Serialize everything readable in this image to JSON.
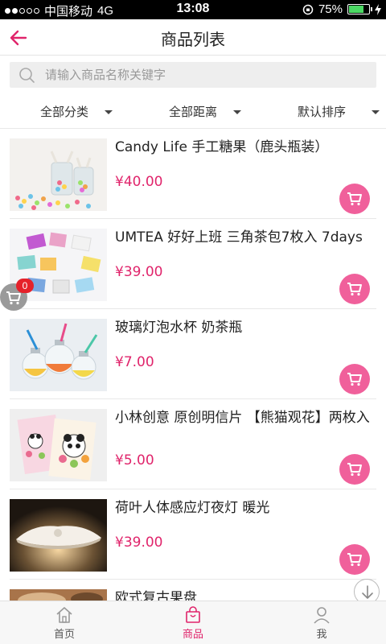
{
  "status_bar": {
    "carrier": "中国移动",
    "network": "4G",
    "time": "13:08",
    "battery": "75%",
    "battery_level": 0.75
  },
  "header": {
    "title": "商品列表",
    "back_icon": "back-arrow-icon"
  },
  "search": {
    "placeholder": "请输入商品名称关键字"
  },
  "filters": [
    {
      "label": "全部分类"
    },
    {
      "label": "全部距离"
    },
    {
      "label": "默认排序"
    }
  ],
  "products": [
    {
      "name": "Candy Life 手工糖果（鹿头瓶装）",
      "price": "¥40.00"
    },
    {
      "name": "UMTEA 好好上班 三角茶包7枚入 7days",
      "price": "¥39.00"
    },
    {
      "name": "玻璃灯泡水杯 奶茶瓶",
      "price": "¥7.00"
    },
    {
      "name": "小林创意 原创明信片 【熊猫观花】两枚入",
      "price": "¥5.00"
    },
    {
      "name": "荷叶人体感应灯夜灯 暖光",
      "price": "¥39.00"
    },
    {
      "name": "欧式复古果盘",
      "price": ""
    }
  ],
  "float_cart": {
    "count": "0"
  },
  "tabbar": [
    {
      "label": "首页",
      "icon": "home-icon"
    },
    {
      "label": "商品",
      "icon": "shopping-bag-icon"
    },
    {
      "label": "我",
      "icon": "user-icon"
    }
  ],
  "colors": {
    "accent": "#e0246b",
    "cart_button": "#f0609b",
    "badge": "#e5212a"
  }
}
